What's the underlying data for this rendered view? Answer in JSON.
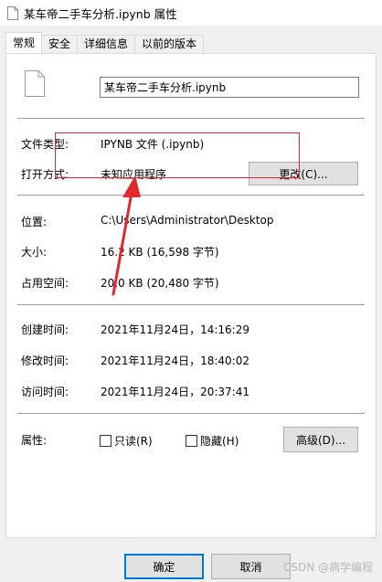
{
  "window": {
    "title": "某车帝二手车分析.ipynb 属性"
  },
  "tabs": [
    {
      "label": "常规",
      "active": true
    },
    {
      "label": "安全",
      "active": false
    },
    {
      "label": "详细信息",
      "active": false
    },
    {
      "label": "以前的版本",
      "active": false
    }
  ],
  "file": {
    "name": "某车帝二手车分析.ipynb"
  },
  "props": {
    "type_label": "文件类型:",
    "type_value": "IPYNB 文件 (.ipynb)",
    "open_label": "打开方式:",
    "open_value": "未知应用程序",
    "change_button": "更改(C)...",
    "location_label": "位置:",
    "location_value": "C:\\Users\\Administrator\\Desktop",
    "size_label": "大小:",
    "size_value": "16.2 KB (16,598 字节)",
    "disk_label": "占用空间:",
    "disk_value": "20.0 KB (20,480 字节)",
    "created_label": "创建时间:",
    "created_value": "2021年11月24日，14:16:29",
    "modified_label": "修改时间:",
    "modified_value": "2021年11月24日，18:40:02",
    "accessed_label": "访问时间:",
    "accessed_value": "2021年11月24日，20:37:41",
    "attr_label": "属性:",
    "readonly_label": "只读(R)",
    "readonly_checked": false,
    "hidden_label": "隐藏(H)",
    "hidden_checked": false,
    "advanced_button": "高级(D)..."
  },
  "footer": {
    "ok_button": "确定",
    "cancel_button": "取消",
    "watermark": "CSDN @病学编程"
  },
  "colors": {
    "annotation": "#e0282e",
    "default_button_border": "#0078d7"
  }
}
